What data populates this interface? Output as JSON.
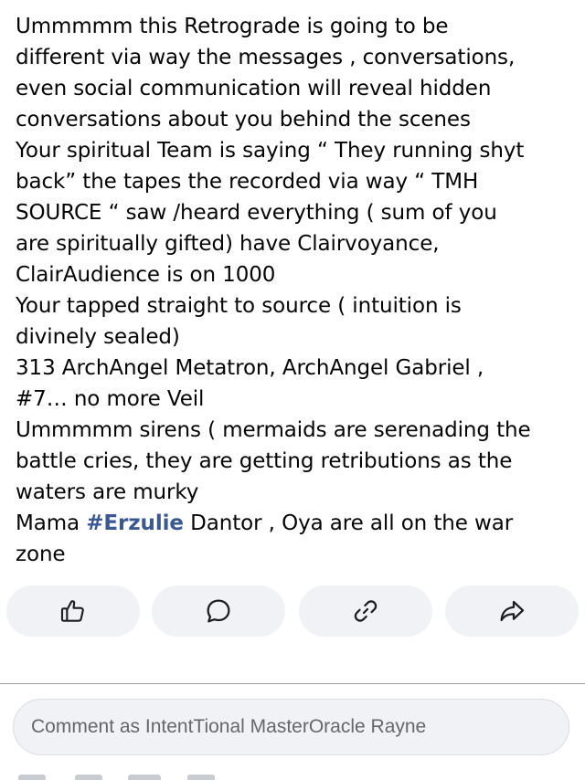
{
  "post": {
    "lines": [
      {
        "text": "Ummmmm this Retrograde is going to be"
      },
      {
        "text": "different via way the messages , conversations,"
      },
      {
        "text": "even social communication will reveal hidden"
      },
      {
        "text": "conversations about you behind the scenes"
      },
      {
        "text": "Your spiritual Team is saying “ They running shyt"
      },
      {
        "text": "back” the tapes the recorded via way “ TMH"
      },
      {
        "text": "SOURCE “ saw /heard everything ( sum of you"
      },
      {
        "text": "are spiritually gifted) have Clairvoyance,"
      },
      {
        "text": "ClairAudience is on 1000"
      },
      {
        "text": "Your tapped straight to source ( intuition is"
      },
      {
        "text": "divinely sealed)"
      },
      {
        "text": "313 ArchAngel Metatron, ArchAngel Gabriel ,"
      },
      {
        "text": "#7… no more Veil"
      },
      {
        "text": "Ummmmm sirens ( mermaids are serenading the"
      },
      {
        "text": "battle cries, they are getting retributions as the"
      },
      {
        "text": "waters are murky"
      },
      {
        "before": "Mama ",
        "hashtag": "#Erzulie",
        "after": " Dantor , Oya are all on the war"
      },
      {
        "text": "zone"
      }
    ],
    "hashtag_color": "#385898"
  },
  "actions": [
    {
      "name": "like",
      "icon": "thumbs-up-icon"
    },
    {
      "name": "comment",
      "icon": "speech-bubble-icon"
    },
    {
      "name": "copy-link",
      "icon": "link-icon"
    },
    {
      "name": "share",
      "icon": "share-arrow-icon"
    }
  ],
  "comment": {
    "placeholder": "Comment as IntentTional MasterOracle Rayne"
  },
  "colors": {
    "button_bg": "#f0f2f5",
    "icon": "#1c1e21",
    "placeholder": "#65676b"
  }
}
